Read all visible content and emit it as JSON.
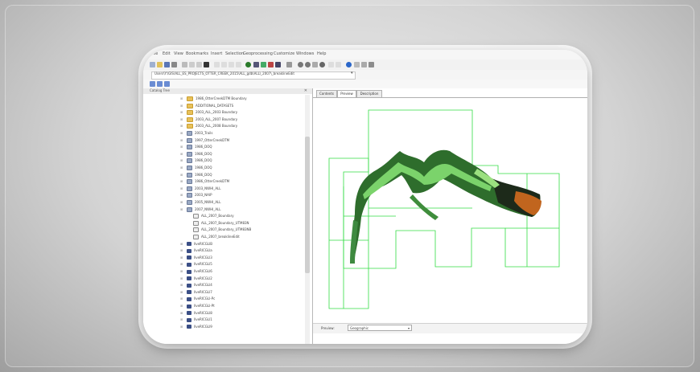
{
  "menubar": {
    "items": [
      "File",
      "Edit",
      "View",
      "Bookmarks",
      "Insert",
      "Selection",
      "Geoprocessing",
      "Customize",
      "Windows",
      "Help"
    ]
  },
  "toolbar": {
    "icons": [
      "new-icon",
      "open-icon",
      "save-icon",
      "print-icon",
      "cut-icon",
      "copy-icon",
      "paste-icon",
      "delete-icon",
      "undo-icon",
      "redo-icon",
      "add-data-icon",
      "scale-icon",
      "editor-icon",
      "table-icon",
      "toolbox-icon",
      "python-icon",
      "search-icon",
      "catalog-icon",
      "zoom-in-icon",
      "zoom-out-icon",
      "pan-icon",
      "full-extent-icon",
      "back-icon",
      "forward-icon",
      "select-icon",
      "identify-icon",
      "find-icon",
      "measure-icon"
    ]
  },
  "pathbar": {
    "path": "Users\\Y:\\GIS\\ALL_ES_PROJECTS_OTTER_CREEK_2015\\ALL_gdb\\ALL\\_2007\\_breaklineEdit",
    "dropdown_icon": "chevron-down-icon"
  },
  "toc": {
    "title": "Catalog Tree",
    "close_symbol": "✕",
    "rows": [
      {
        "label": "1986_OtterCreekDTM Boundary",
        "icon": "folder"
      },
      {
        "label": "ADDITIONAL_DATASETS",
        "icon": "folder"
      },
      {
        "label": "2003_ALL_2003 Boundary",
        "icon": "folder"
      },
      {
        "label": "2003_ALL_2007 Boundary",
        "icon": "folder"
      },
      {
        "label": "2003_ALL_2008 Boundary",
        "icon": "folder"
      },
      {
        "label": "2003_Trails",
        "icon": "grid"
      },
      {
        "label": "1997_OtterCreekDTM",
        "icon": "grid"
      },
      {
        "label": "1986_DOQ",
        "icon": "grid"
      },
      {
        "label": "1986_DOQ",
        "icon": "grid"
      },
      {
        "label": "1986_DOQ",
        "icon": "grid"
      },
      {
        "label": "1986_DOQ",
        "icon": "grid"
      },
      {
        "label": "1986_DOQ",
        "icon": "grid"
      },
      {
        "label": "1986_OtterCreekDTM",
        "icon": "grid"
      },
      {
        "label": "2003_NWHI_ALL",
        "icon": "grid"
      },
      {
        "label": "2003_NAIP",
        "icon": "grid"
      },
      {
        "label": "2005_NWHI_ALL",
        "icon": "grid"
      },
      {
        "label": "2007_NWHI_ALL",
        "icon": "grid"
      },
      {
        "label": "ALL_2007_Boundary",
        "icon": "line"
      },
      {
        "label": "ALL_2007_Boundary_UTM83N",
        "icon": "line"
      },
      {
        "label": "ALL_2007_Boundary_UTM83NB",
        "icon": "line"
      },
      {
        "label": "ALL_2007_breaklineEdit",
        "icon": "line"
      },
      {
        "label": "llveRICGLIB",
        "icon": "raster"
      },
      {
        "label": "llveRICGLIa",
        "icon": "raster"
      },
      {
        "label": "llveRICGLI3",
        "icon": "raster"
      },
      {
        "label": "llveRICGLI5",
        "icon": "raster"
      },
      {
        "label": "llveRICGLI6",
        "icon": "raster"
      },
      {
        "label": "llveRICGLI2",
        "icon": "raster"
      },
      {
        "label": "llveRICGLI4",
        "icon": "raster"
      },
      {
        "label": "llveRICGLI7",
        "icon": "raster"
      },
      {
        "label": "llveRICGLI-Pc",
        "icon": "raster"
      },
      {
        "label": "llveRICGLI-Pt",
        "icon": "raster"
      },
      {
        "label": "llveRICGLI8",
        "icon": "raster"
      },
      {
        "label": "llveRICGLI1",
        "icon": "raster"
      },
      {
        "label": "llveRICGLI9",
        "icon": "raster"
      }
    ]
  },
  "map": {
    "tabs": [
      "Contents",
      "Preview",
      "Description"
    ],
    "active_tab": "Preview",
    "footer_label": "Preview:",
    "footer_select": "Geographic",
    "colors": {
      "outline": "#33dd44",
      "dem_low": "#1f7a2e",
      "dem_mid": "#7bd36b",
      "dem_high": "#c1651e",
      "dem_dark": "#1d2a1a"
    }
  }
}
